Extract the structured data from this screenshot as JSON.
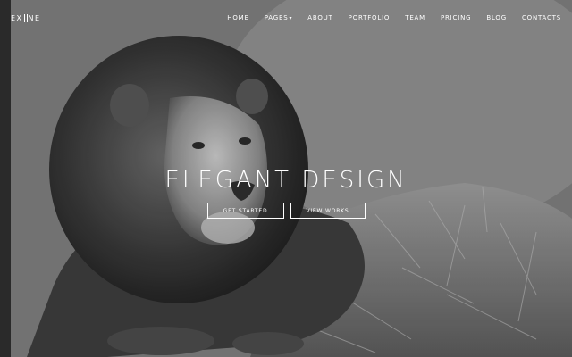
{
  "brand": {
    "logo_left": "EX",
    "logo_right": "NE"
  },
  "nav": {
    "items": [
      {
        "label": "HOME"
      },
      {
        "label": "PAGES",
        "has_dropdown": true,
        "caret": "▾"
      },
      {
        "label": "ABOUT"
      },
      {
        "label": "PORTFOLIO"
      },
      {
        "label": "TEAM"
      },
      {
        "label": "PRICING"
      },
      {
        "label": "BLOG"
      },
      {
        "label": "CONTACTS"
      }
    ]
  },
  "hero": {
    "title": "ELEGANT DESIGN",
    "primary_button": "GET STARTED",
    "secondary_button": "VIEW WORKS",
    "background_image": "lion-photo"
  },
  "colors": {
    "text": "#ffffff",
    "background": "#5e5e5e"
  }
}
